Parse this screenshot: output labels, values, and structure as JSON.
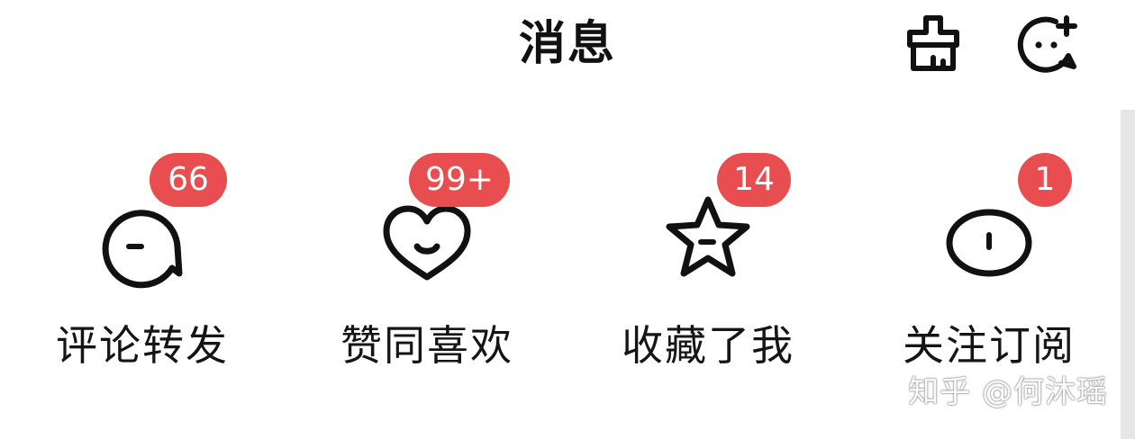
{
  "header": {
    "title": "消息",
    "clear_icon": "broom-clean-icon",
    "new_chat_icon": "chat-add-icon"
  },
  "tiles": [
    {
      "label": "评论转发",
      "badge": "66",
      "icon": "comment-bubble-icon"
    },
    {
      "label": "赞同喜欢",
      "badge": "99+",
      "icon": "heart-smile-icon"
    },
    {
      "label": "收藏了我",
      "badge": "14",
      "icon": "star-icon"
    },
    {
      "label": "关注订阅",
      "badge": "1",
      "icon": "follow-oval-icon"
    }
  ],
  "colors": {
    "badge": "#e84d4f",
    "text": "#111111",
    "background": "#ffffff"
  },
  "watermark": "知乎 @何沐瑶"
}
